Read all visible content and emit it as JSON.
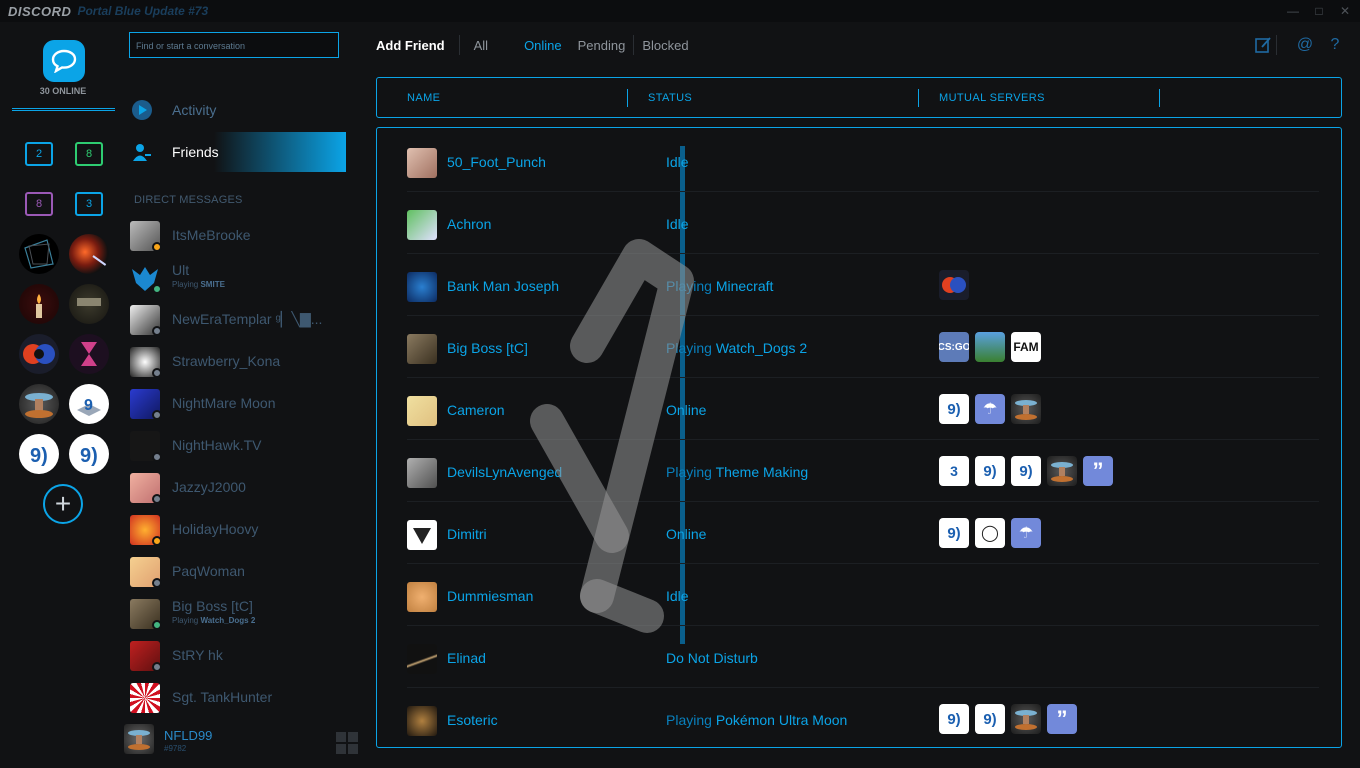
{
  "titlebar": {
    "brand": "DISCORD",
    "subtitle": "Portal Blue Update #73"
  },
  "guilds": {
    "online_count": "30 ONLINE",
    "folders": [
      {
        "count": "2",
        "color": "#0ba4e7"
      },
      {
        "count": "8",
        "color": "#2ecc71"
      },
      {
        "count": "8",
        "color": "#9b59b6"
      },
      {
        "count": "3",
        "color": "#0ba4e7"
      }
    ],
    "add_label": "+"
  },
  "sidebar": {
    "search_placeholder": "Find or start a conversation",
    "nav": [
      {
        "label": "Activity"
      },
      {
        "label": "Friends"
      }
    ],
    "dm_header": "DIRECT MESSAGES",
    "dms": [
      {
        "name": "ItsMeBrooke",
        "status": "idle",
        "sub": "",
        "sub_bold": ""
      },
      {
        "name": "Ult",
        "status": "online",
        "sub": "Playing ",
        "sub_bold": "SMITE"
      },
      {
        "name": "NewEraTemplar ᵍ▏╲▇...",
        "status": "offline",
        "sub": "",
        "sub_bold": ""
      },
      {
        "name": "Strawberry_Kona",
        "status": "offline",
        "sub": "",
        "sub_bold": ""
      },
      {
        "name": "NightMare Moon",
        "status": "offline",
        "sub": "",
        "sub_bold": ""
      },
      {
        "name": "NightHawk.TV",
        "status": "offline",
        "sub": "",
        "sub_bold": ""
      },
      {
        "name": "JazzyJ2000",
        "status": "offline",
        "sub": "",
        "sub_bold": ""
      },
      {
        "name": "HolidayHoovy",
        "status": "idle",
        "sub": "",
        "sub_bold": ""
      },
      {
        "name": "PaqWoman",
        "status": "offline",
        "sub": "",
        "sub_bold": ""
      },
      {
        "name": "Big Boss [tC]",
        "status": "online",
        "sub": "Playing ",
        "sub_bold": "Watch_Dogs 2"
      },
      {
        "name": "StRY hk",
        "status": "offline",
        "sub": "",
        "sub_bold": ""
      },
      {
        "name": "Sgt. TankHunter",
        "status": "offline",
        "sub": "",
        "sub_bold": ""
      }
    ],
    "user": {
      "name": "NFLD99",
      "tag": "#9782"
    }
  },
  "tabs": {
    "add_friend": "Add Friend",
    "all": "All",
    "online": "Online",
    "pending": "Pending",
    "blocked": "Blocked"
  },
  "columns": {
    "name": "NAME",
    "status": "STATUS",
    "mutual": "MUTUAL SERVERS"
  },
  "friends": [
    {
      "name": "50_Foot_Punch",
      "status_prefix": "",
      "status": "Idle",
      "servers": []
    },
    {
      "name": "Achron",
      "status_prefix": "",
      "status": "Idle",
      "servers": []
    },
    {
      "name": "Bank Man Joseph",
      "status_prefix": "Playing ",
      "status": "Minecraft",
      "servers": [
        "orb"
      ]
    },
    {
      "name": "Big Boss [tC]",
      "status_prefix": "Playing ",
      "status": "Watch_Dogs 2",
      "servers": [
        "csgo",
        "pixel",
        "fam"
      ]
    },
    {
      "name": "Cameron",
      "status_prefix": "",
      "status": "Online",
      "servers": [
        "s9",
        "ghost",
        "portal"
      ]
    },
    {
      "name": "DevilsLynAvenged",
      "status_prefix": "Playing ",
      "status": "Theme Making",
      "servers": [
        "s3d",
        "s9",
        "s9",
        "portal",
        "quote"
      ]
    },
    {
      "name": "Dimitri",
      "status_prefix": "",
      "status": "Online",
      "servers": [
        "s9",
        "bulb",
        "ghost"
      ]
    },
    {
      "name": "Dummiesman",
      "status_prefix": "",
      "status": "Idle",
      "servers": []
    },
    {
      "name": "Elinad",
      "status_prefix": "",
      "status": "Do Not Disturb",
      "servers": []
    },
    {
      "name": "Esoteric",
      "status_prefix": "Playing ",
      "status": "Pokémon Ultra Moon",
      "servers": [
        "s9",
        "s9",
        "portal",
        "quote"
      ]
    }
  ],
  "colors": {
    "accent": "#0ba4e7",
    "idle": "#faa61a",
    "online": "#43b581",
    "offline": "#747f8d"
  }
}
